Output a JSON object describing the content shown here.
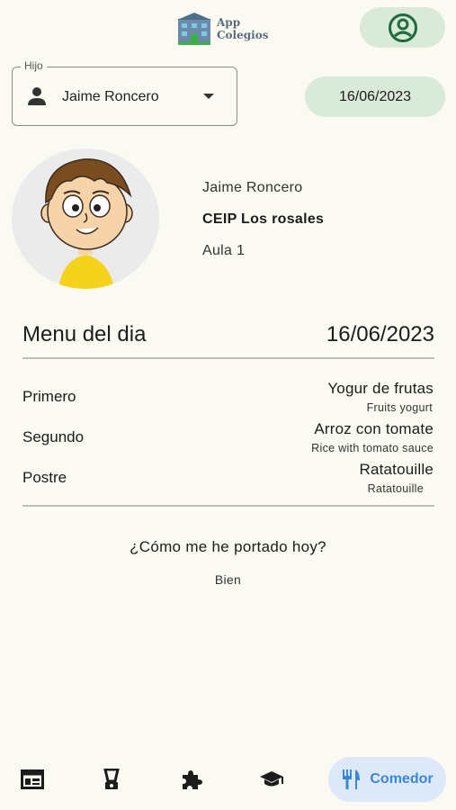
{
  "header": {
    "app_name_line1": "App",
    "app_name_line2": "Colegios",
    "profile_icon": "account-circle-icon"
  },
  "child_selector": {
    "label": "Hijo",
    "selected": "Jaime Roncero"
  },
  "date_button": "16/06/2023",
  "student": {
    "name": "Jaime Roncero",
    "school": "CEIP Los rosales",
    "classroom": "Aula 1"
  },
  "menu": {
    "title": "Menu del dia",
    "date": "16/06/2023",
    "courses": [
      {
        "label": "Primero",
        "dish": "Yogur de frutas",
        "translation": "Fruits yogurt"
      },
      {
        "label": "Segundo",
        "dish": "Arroz con tomate",
        "translation": "Rice with tomato sauce"
      },
      {
        "label": "Postre",
        "dish": "Ratatouille",
        "translation": "Ratatouille"
      }
    ]
  },
  "behavior": {
    "question": "¿Cómo me he portado hoy?",
    "answer": "Bien"
  },
  "bottom_nav": {
    "items": [
      "schedule-icon",
      "blender-icon",
      "puzzle-icon",
      "graduation-cap-icon"
    ],
    "active_label": "Comedor",
    "active_icon": "fork-knife-icon"
  },
  "colors": {
    "background": "#fafaf2",
    "pill_green": "#d9ead8",
    "icon_green": "#1e6b3c",
    "active_blue": "#3a86d8",
    "active_bg": "#dde9f8"
  }
}
